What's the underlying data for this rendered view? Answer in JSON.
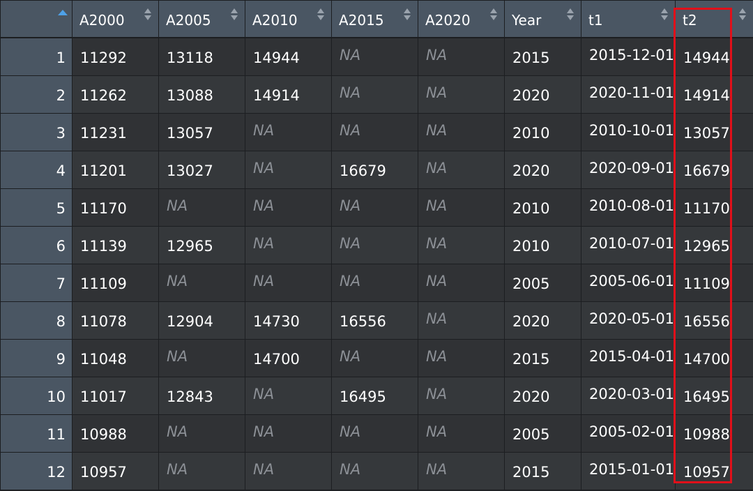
{
  "table": {
    "columns": [
      {
        "key": "A2000",
        "label": "A2000"
      },
      {
        "key": "A2005",
        "label": "A2005"
      },
      {
        "key": "A2010",
        "label": "A2010"
      },
      {
        "key": "A2015",
        "label": "A2015"
      },
      {
        "key": "A2020",
        "label": "A2020"
      },
      {
        "key": "Year",
        "label": "Year"
      },
      {
        "key": "t1",
        "label": "t1"
      },
      {
        "key": "t2",
        "label": "t2"
      }
    ],
    "rows": [
      {
        "n": "1",
        "cells": [
          "11292",
          "13118",
          "14944",
          "NA",
          "NA",
          "2015",
          "2015-12-01",
          "14944"
        ]
      },
      {
        "n": "2",
        "cells": [
          "11262",
          "13088",
          "14914",
          "NA",
          "NA",
          "2020",
          "2020-11-01",
          "14914"
        ]
      },
      {
        "n": "3",
        "cells": [
          "11231",
          "13057",
          "NA",
          "NA",
          "NA",
          "2010",
          "2010-10-01",
          "13057"
        ]
      },
      {
        "n": "4",
        "cells": [
          "11201",
          "13027",
          "NA",
          "16679",
          "NA",
          "2020",
          "2020-09-01",
          "16679"
        ]
      },
      {
        "n": "5",
        "cells": [
          "11170",
          "NA",
          "NA",
          "NA",
          "NA",
          "2010",
          "2010-08-01",
          "11170"
        ]
      },
      {
        "n": "6",
        "cells": [
          "11139",
          "12965",
          "NA",
          "NA",
          "NA",
          "2010",
          "2010-07-01",
          "12965"
        ]
      },
      {
        "n": "7",
        "cells": [
          "11109",
          "NA",
          "NA",
          "NA",
          "NA",
          "2005",
          "2005-06-01",
          "11109"
        ]
      },
      {
        "n": "8",
        "cells": [
          "11078",
          "12904",
          "14730",
          "16556",
          "NA",
          "2020",
          "2020-05-01",
          "16556"
        ]
      },
      {
        "n": "9",
        "cells": [
          "11048",
          "NA",
          "14700",
          "NA",
          "NA",
          "2015",
          "2015-04-01",
          "14700"
        ]
      },
      {
        "n": "10",
        "cells": [
          "11017",
          "12843",
          "NA",
          "16495",
          "NA",
          "2020",
          "2020-03-01",
          "16495"
        ]
      },
      {
        "n": "11",
        "cells": [
          "10988",
          "NA",
          "NA",
          "NA",
          "NA",
          "2005",
          "2005-02-01",
          "10988"
        ]
      },
      {
        "n": "12",
        "cells": [
          "10957",
          "NA",
          "NA",
          "NA",
          "NA",
          "2015",
          "2015-01-01",
          "10957"
        ]
      }
    ],
    "sort_indicator": "ascending",
    "highlighted_column": "t2"
  },
  "colors": {
    "header_bg": "#4a5663",
    "cell_bg": "#303235",
    "na_text": "#8c9096",
    "sort_active": "#4ea1e8",
    "highlight": "#e0101a"
  },
  "icons": {
    "index_sort": "sort-ascending-icon",
    "column_sort": "sort-toggle-icon"
  }
}
